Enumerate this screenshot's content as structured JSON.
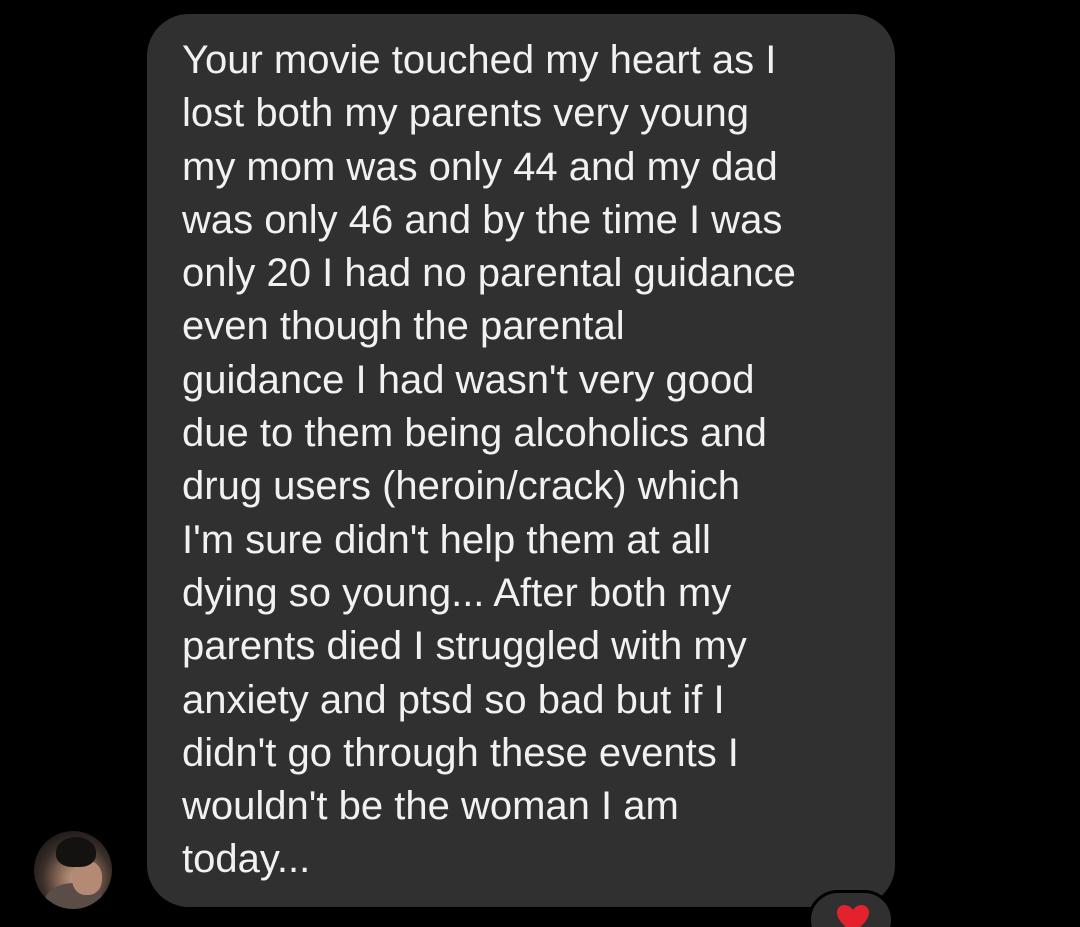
{
  "message": {
    "lines": [
      "Your movie touched my heart as I",
      "lost both my parents very young",
      "my mom was only 44 and my dad",
      "was only 46 and by the time I was",
      "only 20 I had no parental guidance",
      "even though the parental",
      "guidance I had wasn't very good",
      "due to them being alcoholics and",
      "drug users (heroin/crack) which",
      "I'm sure didn't help them at all",
      "dying so young... After both my",
      "parents died I struggled with my",
      "anxiety and ptsd so bad but if I",
      "didn't go through these events I",
      "wouldn't be the woman I am",
      "today..."
    ]
  },
  "sender": {
    "avatar_icon": "profile-photo"
  },
  "reaction": {
    "icon": "heart-icon",
    "color": "#e4222e"
  },
  "colors": {
    "background": "#000000",
    "bubble": "#303030",
    "text": "#f1f1f1"
  }
}
